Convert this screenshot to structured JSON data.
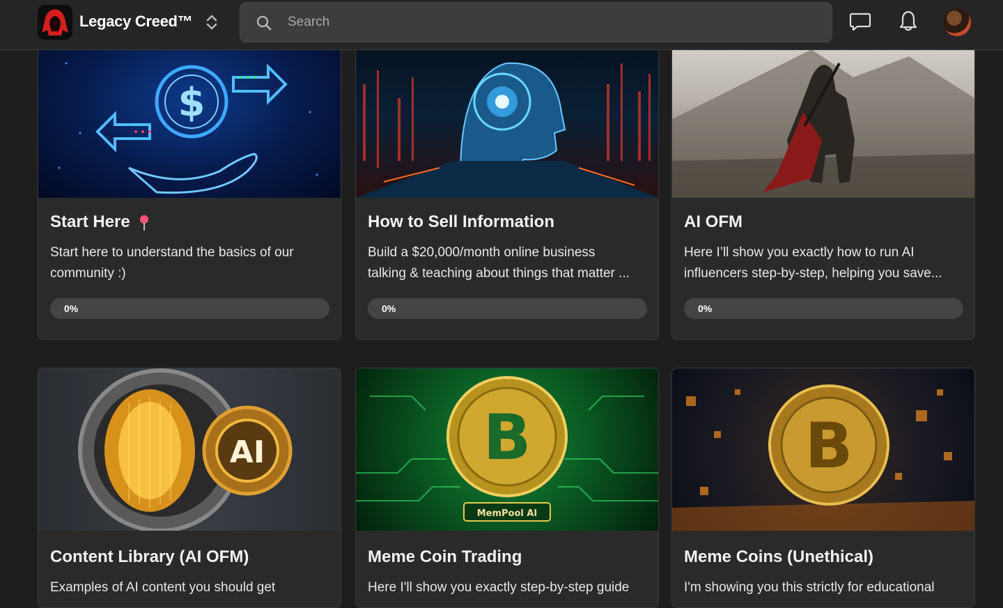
{
  "header": {
    "brand": "Legacy Creed™",
    "search_placeholder": "Search"
  },
  "courses": [
    {
      "title": "Start Here",
      "desc_line1": "Start here to understand the basics of our",
      "desc_line2": "community :)",
      "progress_label": "0%",
      "progress": 0,
      "image": "money-transfer-hand"
    },
    {
      "title": "How to Sell Information",
      "desc_line1": "Build a $20,000/month online business",
      "desc_line2": "talking & teaching about things that matter ...",
      "progress_label": "0%",
      "progress": 0,
      "image": "ai-head"
    },
    {
      "title": "AI OFM",
      "desc_line1": "Here I’ll show you exactly how to run AI",
      "desc_line2": "influencers step-by-step, helping you save...",
      "progress_label": "0%",
      "progress": 0,
      "image": "hooded-warrior"
    },
    {
      "title": "Content Library (AI OFM)",
      "desc_line1": "Examples of AI content you should get",
      "image": "ai-vault",
      "image_text": "AI"
    },
    {
      "title": "Meme Coin Trading",
      "desc_line1": "Here I'll show you exactly step-by-step guide",
      "image": "bitcoin-circuit",
      "image_text": "MemPool AI"
    },
    {
      "title": "Meme Coins (Unethical)",
      "desc_line1": "I'm showing you this strictly for educational",
      "image": "bitcoin-bokeh"
    }
  ]
}
